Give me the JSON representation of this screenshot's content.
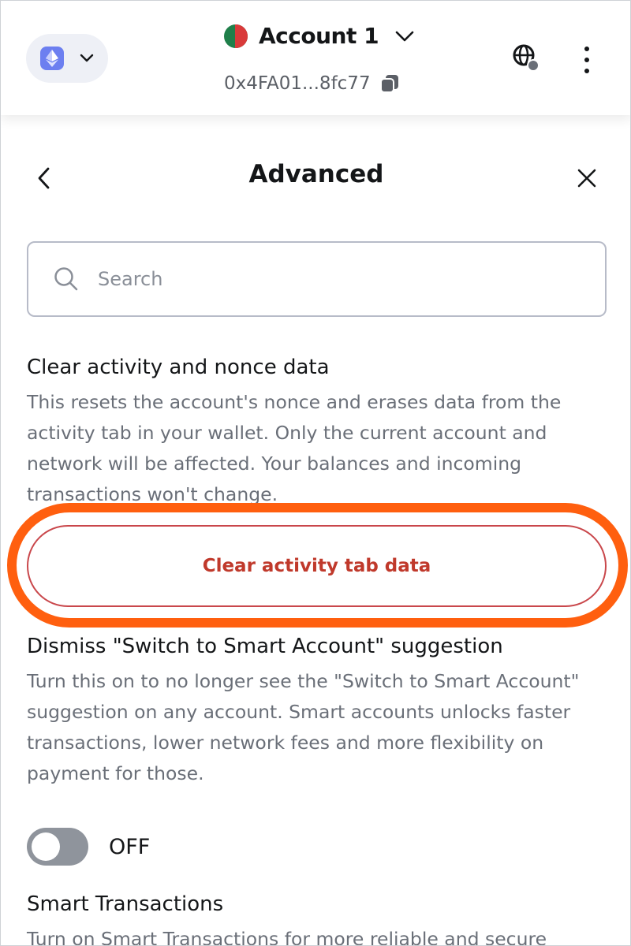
{
  "header": {
    "network_icon": "ethereum-icon",
    "account_name": "Account 1",
    "address": "0x4FA01...8fc77",
    "colors": {
      "network_pill_bg": "#eef0f6",
      "eth_badge": "#6c7ff0"
    }
  },
  "page": {
    "title": "Advanced",
    "back_icon": "chevron-left-icon",
    "close_icon": "close-icon"
  },
  "search": {
    "placeholder": "Search",
    "value": ""
  },
  "settings": {
    "clear_activity": {
      "title": "Clear activity and nonce data",
      "description": "This resets the account's nonce and erases data from the activity tab in your wallet. Only the current account and network will be affected. Your balances and incoming transactions won't change.",
      "button_label": "Clear activity tab data"
    },
    "dismiss_smart_account": {
      "title": "Dismiss \"Switch to Smart Account\" suggestion",
      "description": "Turn this on to no longer see the \"Switch to Smart Account\" suggestion on any account. Smart accounts unlocks faster transactions, lower network fees and more flexibility on payment for those.",
      "toggle_state": "OFF"
    },
    "smart_transactions": {
      "title": "Smart Transactions",
      "description": "Turn on Smart Transactions for more reliable and secure"
    }
  },
  "colors": {
    "danger": "#c0392b",
    "highlight_ring": "#ff5f0f",
    "toggle_off": "#8f949c"
  }
}
